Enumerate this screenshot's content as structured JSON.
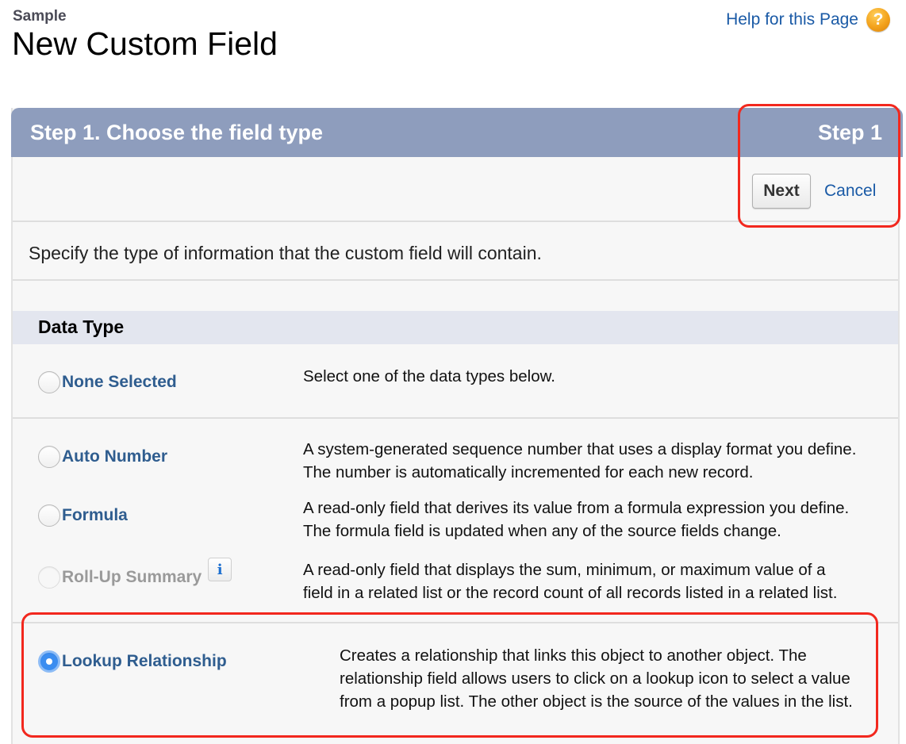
{
  "header": {
    "object_name": "Sample",
    "page_title": "New Custom Field",
    "help_link": "Help for this Page",
    "help_icon": "question-mark-icon"
  },
  "block": {
    "title": "Step 1. Choose the field type",
    "step_label": "Step 1",
    "buttons": {
      "next": "Next",
      "cancel": "Cancel"
    },
    "instructions": "Specify the type of information that the custom field will contain.",
    "section_header": "Data Type"
  },
  "data_types": [
    {
      "label": "None Selected",
      "description": "Select one of the data types below.",
      "selected": false,
      "disabled": false
    },
    {
      "label": "Auto Number",
      "description": "A system-generated sequence number that uses a display format you define. The number is automatically incremented for each new record.",
      "selected": false,
      "disabled": false
    },
    {
      "label": "Formula",
      "description": "A read-only field that derives its value from a formula expression you define. The formula field is updated when any of the source fields change.",
      "selected": false,
      "disabled": false
    },
    {
      "label": "Roll-Up Summary",
      "description": "A read-only field that displays the sum, minimum, or maximum value of a field in a related list or the record count of all records listed in a related list.",
      "selected": false,
      "disabled": true,
      "info_icon": "info-icon"
    },
    {
      "label": "Lookup Relationship",
      "description": "Creates a relationship that links this object to another object. The relationship field allows users to click on a lookup icon to select a value from a popup list. The other object is the source of the values in the list.",
      "selected": true,
      "disabled": false
    }
  ],
  "colors": {
    "header_bar": "#8e9dbd",
    "link": "#1a5aa6",
    "option_label": "#2f5d8f",
    "highlight": "#f2281e",
    "radio_selected": "#3b8df0"
  }
}
